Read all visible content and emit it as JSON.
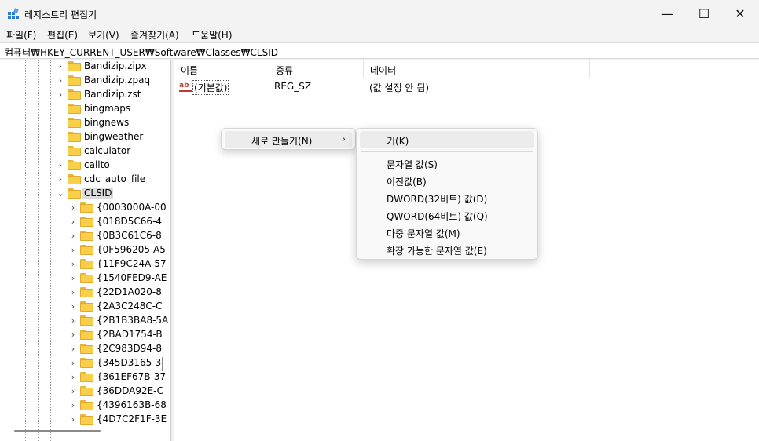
{
  "window": {
    "title": "레지스트리 편집기",
    "minimize": "—",
    "maximize": "☐",
    "close": "✕"
  },
  "menu": [
    "파일(F)",
    "편집(E)",
    "보기(V)",
    "즐겨찾기(A)",
    "도움말(H)"
  ],
  "address": "컴퓨터₩HKEY_CURRENT_USER₩Software₩Classes₩CLSID",
  "tree": {
    "items": [
      {
        "label": "Bandizip.zipx",
        "chevron": "›"
      },
      {
        "label": "Bandizip.zpaq",
        "chevron": "›"
      },
      {
        "label": "Bandizip.zst",
        "chevron": "›"
      },
      {
        "label": "bingmaps",
        "chevron": ""
      },
      {
        "label": "bingnews",
        "chevron": ""
      },
      {
        "label": "bingweather",
        "chevron": ""
      },
      {
        "label": "calculator",
        "chevron": ""
      },
      {
        "label": "callto",
        "chevron": "›"
      },
      {
        "label": "cdc_auto_file",
        "chevron": "›"
      },
      {
        "label": "CLSID",
        "chevron": "⌄",
        "selected": true
      },
      {
        "label": "{0003000A-00",
        "chevron": "›"
      },
      {
        "label": "{018D5C66-4",
        "chevron": "›"
      },
      {
        "label": "{0B3C61C6-8",
        "chevron": "›"
      },
      {
        "label": "{0F596205-A5",
        "chevron": "›"
      },
      {
        "label": "{11F9C24A-57",
        "chevron": "›"
      },
      {
        "label": "{1540FED9-AE",
        "chevron": "›"
      },
      {
        "label": "{22D1A020-8",
        "chevron": "›"
      },
      {
        "label": "{2A3C248C-C",
        "chevron": "›"
      },
      {
        "label": "{2B1B3BA8-5A",
        "chevron": "›"
      },
      {
        "label": "{2BAD1754-B",
        "chevron": "›"
      },
      {
        "label": "{2C983D94-8",
        "chevron": "›"
      },
      {
        "label": "{345D3165-3",
        "chevron": "›"
      },
      {
        "label": "{361EF67B-37",
        "chevron": "›"
      },
      {
        "label": "{36DDA92E-C",
        "chevron": "›"
      },
      {
        "label": "{4396163B-68",
        "chevron": "›"
      },
      {
        "label": "{4D7C2F1F-3E",
        "chevron": "›"
      }
    ]
  },
  "list": {
    "columns": [
      "이름",
      "종류",
      "데이터"
    ],
    "rows": [
      {
        "name": "(기본값)",
        "type": "REG_SZ",
        "data": "(값 설정 안 됨)",
        "icon": "ab"
      }
    ]
  },
  "context_menu": {
    "item": "새로 만들기(N)",
    "arrow": "›"
  },
  "submenu": {
    "first": "키(K)",
    "items": [
      "문자열 값(S)",
      "이진값(B)",
      "DWORD(32비트) 값(D)",
      "QWORD(64비트) 값(Q)",
      "다중 문자열 값(M)",
      "확장 가능한 문자열 값(E)"
    ]
  }
}
